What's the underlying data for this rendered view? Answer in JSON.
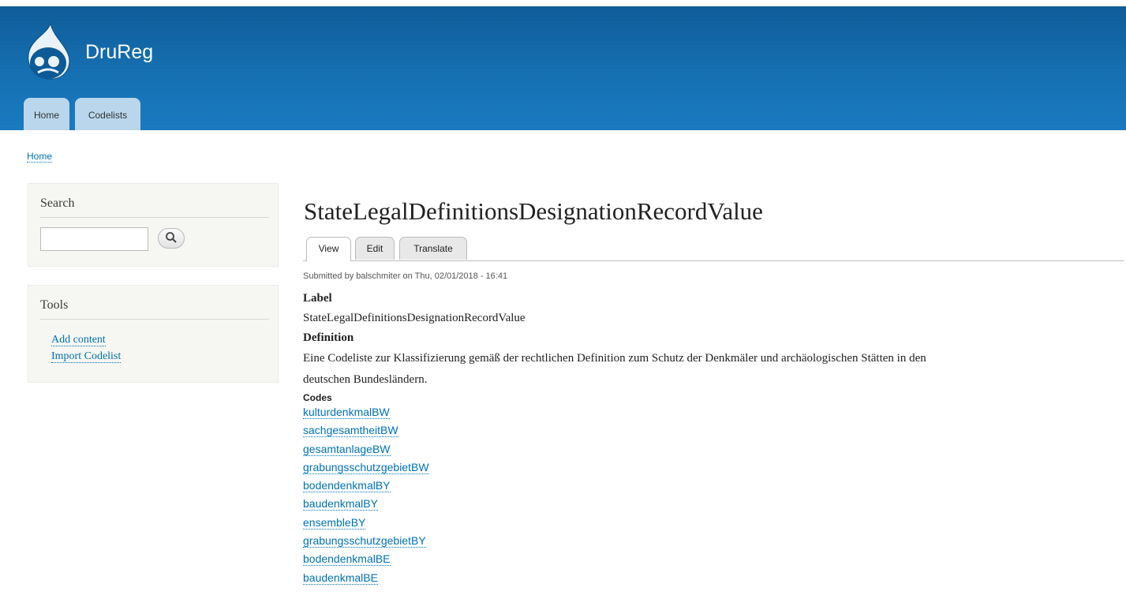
{
  "site": {
    "name": "DruReg"
  },
  "primary_tabs": [
    "Home",
    "Codelists"
  ],
  "breadcrumb": "Home",
  "search_block": {
    "title": "Search",
    "input_value": "",
    "button_icon": "search-icon"
  },
  "tools_block": {
    "title": "Tools",
    "links": [
      "Add content",
      "Import Codelist"
    ]
  },
  "page": {
    "title": "StateLegalDefinitionsDesignationRecordValue",
    "tabs": [
      "View",
      "Edit",
      "Translate"
    ],
    "active_tab": "View",
    "submitted": "Submitted by balschmiter on Thu, 02/01/2018 - 16:41"
  },
  "fields": {
    "label_title": "Label",
    "label_value": "StateLegalDefinitionsDesignationRecordValue",
    "definition_title": "Definition",
    "definition_line1": "Eine Codeliste zur Klassifizierung gemäß der rechtlichen Definition zum Schutz der Denkmäler und archäologischen Stätten in den",
    "definition_line2": "deutschen Bundesländern.",
    "codes_title": "Codes"
  },
  "codes": [
    "kulturdenkmalBW",
    "sachgesamtheitBW",
    "gesamtanlageBW",
    "grabungsschutzgebietBW",
    "bodendenkmalBY",
    "baudenkmalBY",
    "ensembleBY",
    "grabungsschutzgebietBY",
    "bodendenkmalBE",
    "baudenkmalBE"
  ],
  "colors": {
    "header": "#1670b2",
    "tab": "#b9d6ec",
    "link": "#0071b3",
    "sidebar": "#f6f6f2"
  }
}
